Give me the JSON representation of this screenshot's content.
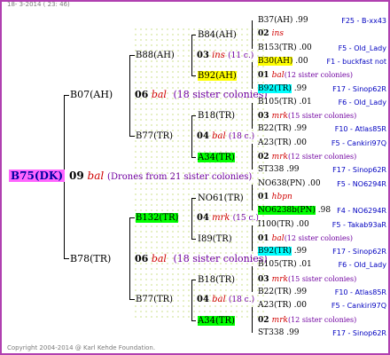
{
  "header": "18- 3-2014 ( 23: 46)",
  "footer": "Copyright 2004-2014 @ Karl Kehde Foundation.",
  "root": {
    "id": "B75(DK)",
    "year": "09",
    "name": "bal",
    "note": "(Drones from 21 sister colonies)"
  },
  "gen1": {
    "father": {
      "id": "B07(AH)",
      "year": "06",
      "name": "bal",
      "note": "(18 sister colonies)"
    },
    "mother": {
      "id": "B78(TR)",
      "year": "06",
      "name": "bal",
      "note": "(18 sister colonies)"
    }
  },
  "gen2": [
    {
      "id": "B88(AH)",
      "year": "03",
      "name": "ins",
      "note": "(11 c.)"
    },
    {
      "id": "B77(TR)",
      "year": "04",
      "name": "bal",
      "note": "(18 c.)"
    },
    {
      "id": "B132(TR)",
      "year": "04",
      "name": "mrk",
      "note": "(15 c.)"
    },
    {
      "id": "B77(TR)",
      "year": "04",
      "name": "bal",
      "note": "(18 c.)"
    }
  ],
  "gen3": [
    "B84(AH)",
    "B92(AH)",
    "B18(TR)",
    "A34(TR)",
    "NO61(TR)",
    "I89(TR)",
    "B18(TR)",
    "A34(TR)"
  ],
  "gen4": [
    {
      "id": "B37(AH)",
      "pct": ".99",
      "src": "F25 - B-xx43"
    },
    {
      "year": "02",
      "name": "ins"
    },
    {
      "id": "B153(TR)",
      "pct": ".00",
      "src": "F5 - Old_Lady"
    },
    {
      "id": "B30(AH)",
      "pct": ".00",
      "src": "F1 - buckfast not"
    },
    {
      "year": "01",
      "name": "bal",
      "note": "(12 sister colonies)"
    },
    {
      "id": "B92(TR)",
      "pct": ".99",
      "src": "F17 - Sinop62R"
    },
    {
      "id": "B105(TR)",
      "pct": ".01",
      "src": "F6 - Old_Lady"
    },
    {
      "year": "03",
      "name": "mrk",
      "note": "(15 sister colonies)"
    },
    {
      "id": "B22(TR)",
      "pct": ".99",
      "src": "F10 - Atlas85R"
    },
    {
      "id": "A23(TR)",
      "pct": ".00",
      "src": "F5 - Cankiri97Q"
    },
    {
      "year": "02",
      "name": "mrk",
      "note": "(12 sister colonies)"
    },
    {
      "id": "ST338",
      "pct": ".99",
      "src": "F17 - Sinop62R"
    },
    {
      "id": "NO638(PN)",
      "pct": ".00",
      "src": "F5 - NO6294R"
    },
    {
      "year": "01",
      "name": "hbpn"
    },
    {
      "id": "NO6238b(PN)",
      "pct": ".98",
      "src": "F4 - NO6294R"
    },
    {
      "id": "I100(TR)",
      "pct": ".00",
      "src": "F5 - Takab93aR"
    },
    {
      "year": "01",
      "name": "bal",
      "note": "(12 sister colonies)"
    },
    {
      "id": "B92(TR)",
      "pct": ".99",
      "src": "F17 - Sinop62R"
    },
    {
      "id": "B105(TR)",
      "pct": ".01",
      "src": "F6 - Old_Lady"
    },
    {
      "year": "03",
      "name": "mrk",
      "note": "(15 sister colonies)"
    },
    {
      "id": "B22(TR)",
      "pct": ".99",
      "src": "F10 - Atlas85R"
    },
    {
      "id": "A23(TR)",
      "pct": ".00",
      "src": "F5 - Cankiri97Q"
    },
    {
      "year": "02",
      "name": "mrk",
      "note": "(12 sister colonies)"
    },
    {
      "id": "ST338",
      "pct": ".99",
      "src": "F17 - Sinop62R"
    }
  ]
}
